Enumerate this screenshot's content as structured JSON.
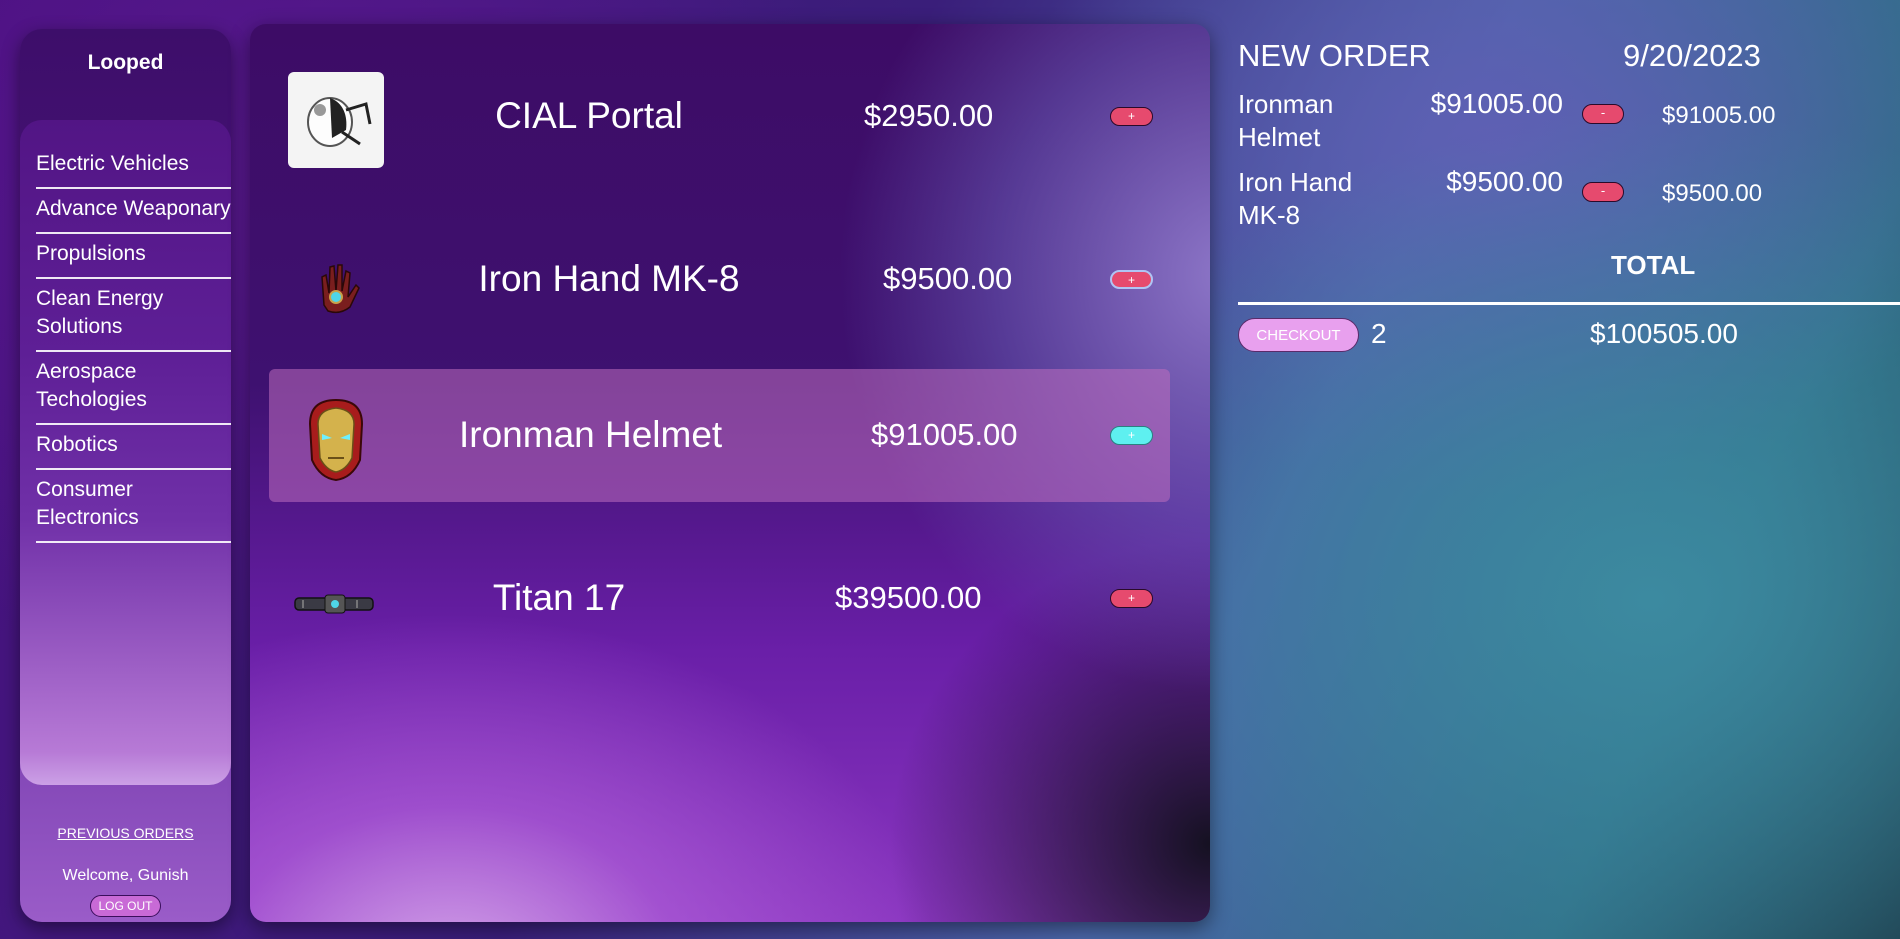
{
  "sidebar": {
    "brand": "Looped",
    "categories": [
      "Electric Vehicles",
      "Advance Weaponary",
      "Propulsions",
      "Clean Energy Solutions",
      "Aerospace Techologies",
      "Robotics",
      "Consumer Electronics"
    ],
    "previous_orders": "PREVIOUS ORDERS",
    "welcome": "Welcome, Gunish",
    "logout": "LOG OUT"
  },
  "products": [
    {
      "name": "CIAL Portal",
      "price": "$2950.00",
      "button": "+",
      "icon": "portal-device-image"
    },
    {
      "name": "Iron Hand MK-8",
      "price": "$9500.00",
      "button": "+",
      "icon": "iron-hand-image"
    },
    {
      "name": "Ironman Helmet",
      "price": "$91005.00",
      "button": "+",
      "icon": "ironman-helmet-image"
    },
    {
      "name": "Titan 17",
      "price": "$39500.00",
      "button": "+",
      "icon": "titan-device-image"
    }
  ],
  "order": {
    "title": "NEW ORDER",
    "date": "9/20/2023",
    "items": [
      {
        "name": "Ironman Helmet",
        "price": "$91005.00",
        "button": "-",
        "subtotal": "$91005.00"
      },
      {
        "name": "Iron Hand MK-8",
        "price": "$9500.00",
        "button": "-",
        "subtotal": "$9500.00"
      }
    ],
    "total_label": "TOTAL",
    "checkout": "CHECKOUT",
    "count": "2",
    "total": "$100505.00"
  },
  "colors": {
    "add_button": "#e64a6e",
    "add_button_selected": "#5ef0f0",
    "checkout": "#e8a0ee",
    "selected_row": "#be6ebe"
  }
}
